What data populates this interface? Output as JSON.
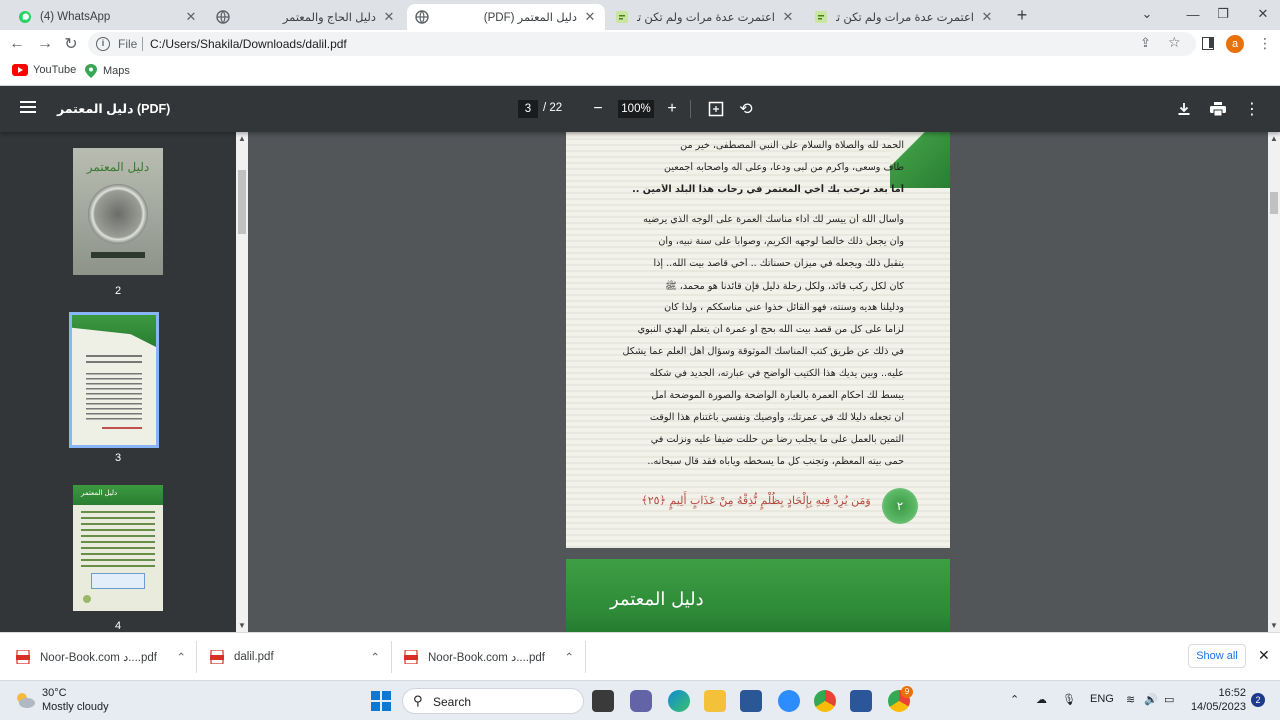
{
  "tabs": [
    {
      "title": "(4) WhatsApp",
      "icon": "whatsapp-icon",
      "active": false
    },
    {
      "title": "دليل الحاج والمعتمر",
      "icon": "globe-icon",
      "active": false
    },
    {
      "title": "دليل المعتمر (PDF)",
      "icon": "globe-icon",
      "active": true
    },
    {
      "title": "اعتمرت عدة مرات ولم تكن تأخذ من",
      "icon": "page-icon",
      "active": false
    },
    {
      "title": "اعتمرت عدة مرات ولم تكن تأخذ من",
      "icon": "page-icon",
      "active": false
    }
  ],
  "toolbar": {
    "file_label": "File",
    "url": "C:/Users/Shakila/Downloads/dalil.pdf",
    "avatar_letter": "a"
  },
  "bookmarks": [
    {
      "label": "YouTube",
      "icon": "youtube-icon"
    },
    {
      "label": "Maps",
      "icon": "maps-icon"
    }
  ],
  "pdf": {
    "title": "دليل المعتمر (PDF)",
    "current_page": "3",
    "total_pages": "22",
    "page_sep": "/",
    "zoom": "100%",
    "thumbnails": [
      {
        "label": "2"
      },
      {
        "label": "3"
      },
      {
        "label": "4"
      }
    ],
    "thumb2_title": "دليل المعتمر",
    "thumb4_title": "دليل المعتمر",
    "page3_lines": [
      "الحمد لله والصلاة والسلام على النبي المصطفى، خير من",
      "طاف وسعى، وأكرم من لبى ودعا، وعلى آله وأصحابه أجمعين",
      "أما بعد نرحب بك أخي المعتمر في رحاب هذا البلد الأمين ..",
      "وأسأل الله أن ييسر لك أداء مناسك العمرة على الوجه الذي يرضيه",
      "وأن يجعل ذلك خالصاً لوجهه الكريم، وصواباً على سنة نبيه، وأن",
      "يتقبل ذلك ويجعله في ميزان حسناتك .. أخي قاصد بيت الله.. إذا",
      "كان لكل ركب قائد، ولكل رحلة دليل فإن قائدنا هو محمد، ﷺ",
      "ودليلنا هديه وسنته، فهو القائل خذوا عني مناسككم ، ولذا كان",
      "لزاما على كل من قصد بيت الله بحج أو عمرة أن يتعلم الهدي النبوي",
      "في ذلك عن طريق كتب المناسك الموثوقة وسؤال أهل العلم عما يشكل",
      "عليه.. وبين يديك هذا الكتيب الواضح في عبارته، الجديد في شكله",
      "يبسط لك أحكام العمرة بالعبارة الواضحة والصورة الموضحة آمل",
      "أن تجعله دليلا لك في عمرتك، وأوصيك ونفسي باغتنام هذا الوقت",
      "الثمين بالعمل على ما يجلب رضا من حللت ضيفاً عليه ونزلت في",
      "حمى بيته المعظم، وتجنب كل ما يسخطه ويأباه فقد قال سبحانه.."
    ],
    "page3_verse": "وَمَن يُرِدْ فِيهِ بِإِلْحَادٍ بِظُلْمٍ نُّذِقْهُ مِنْ عَذَابٍ أَلِيمٍ ﴿٢٥﴾",
    "page3_number": "٢",
    "page4_title": "دليل المعتمر"
  },
  "downloads": {
    "items": [
      {
        "name": "Noor-Book.com د....pdf",
        "icon": "pdf-icon"
      },
      {
        "name": "dalil.pdf",
        "icon": "pdf-icon"
      },
      {
        "name": "Noor-Book.com د....pdf",
        "icon": "pdf-icon"
      }
    ],
    "show_all": "Show all"
  },
  "taskbar": {
    "weather_temp": "30°C",
    "weather_desc": "Mostly cloudy",
    "search_label": "Search",
    "language": "ENG",
    "time": "16:52",
    "date": "14/05/2023",
    "notifications": "2",
    "chrome_badge": "9"
  },
  "colors": {
    "pdf_toolbar": "#323639",
    "viewer_bg": "#525659",
    "accent_green": "#2d8a37",
    "link_blue": "#1a73e8"
  }
}
